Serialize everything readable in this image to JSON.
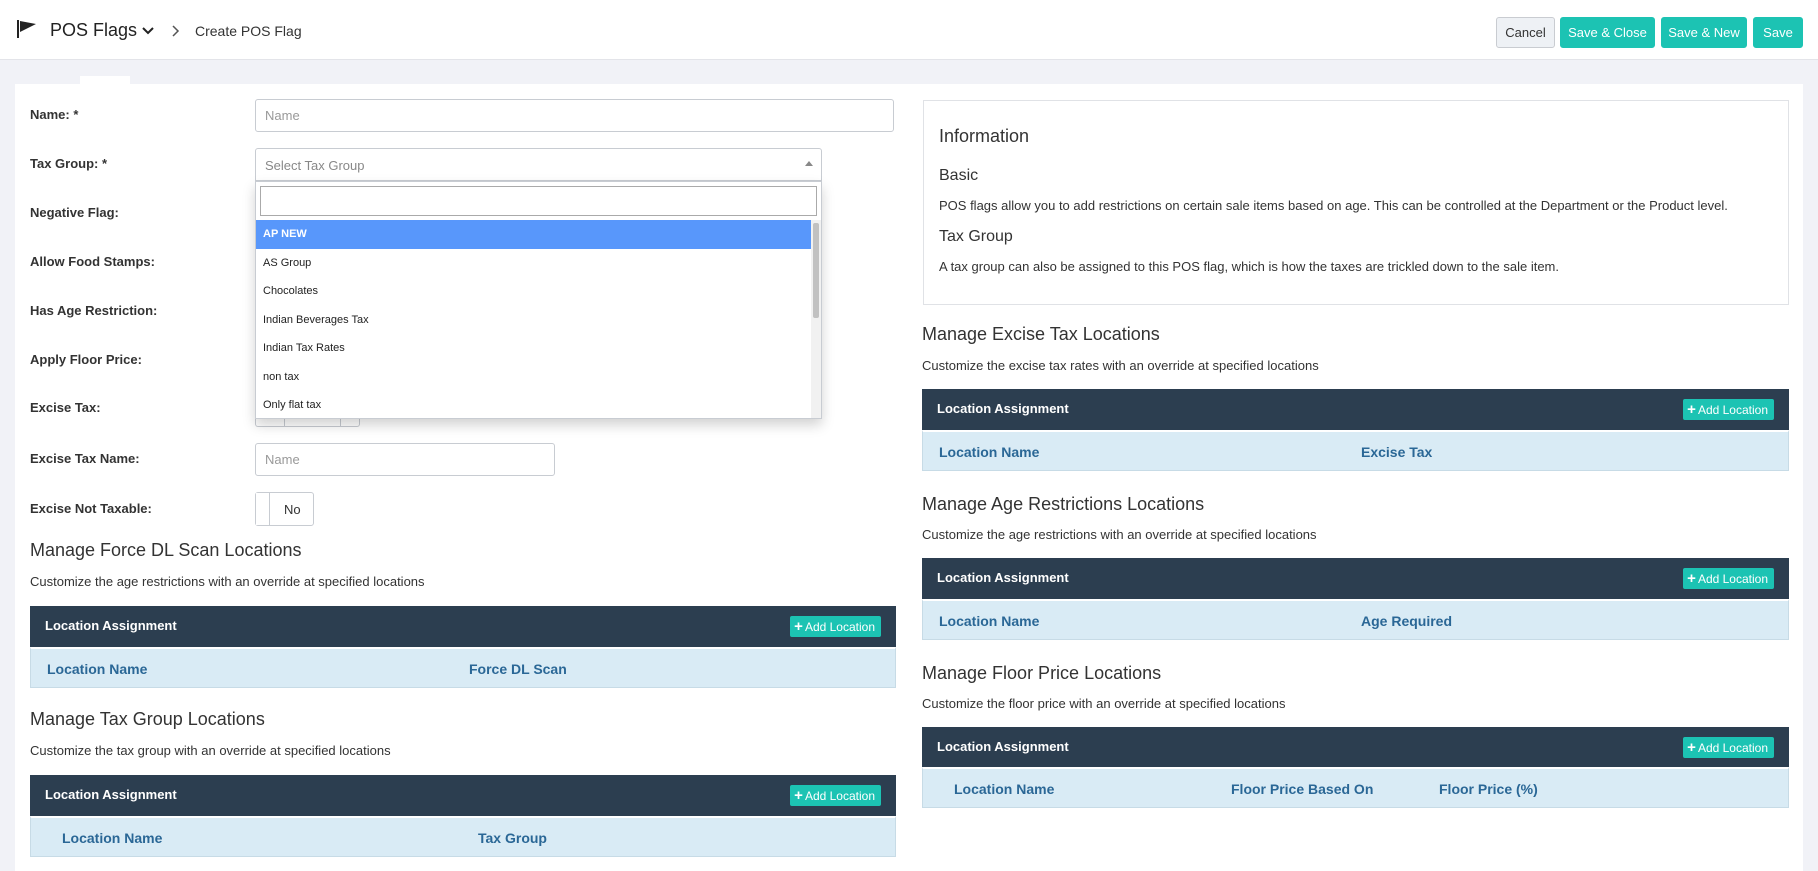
{
  "header": {
    "module_title": "POS Flags",
    "breadcrumb": "Create POS Flag",
    "cancel_label": "Cancel",
    "save_close_label": "Save & Close",
    "save_new_label": "Save & New",
    "save_label": "Save"
  },
  "colors": {
    "accent": "#1cc3b3",
    "dark_bar": "#2c3e50",
    "column_row": "#d9ebf5",
    "selected": "#5897fb"
  },
  "form": {
    "name_label": "Name: *",
    "name_placeholder": "Name",
    "tax_group_label": "Tax Group: *",
    "tax_group_placeholder": "Select Tax Group",
    "negative_flag_label": "Negative Flag:",
    "allow_food_stamps_label": "Allow Food Stamps:",
    "has_age_restriction_label": "Has Age Restriction:",
    "apply_floor_price_label": "Apply Floor Price:",
    "excise_tax_label": "Excise Tax:",
    "excise_tax_name_label": "Excise Tax Name:",
    "excise_tax_name_placeholder": "Name",
    "excise_not_taxable_label": "Excise Not Taxable:",
    "excise_not_taxable_value": "No"
  },
  "dropdown": {
    "options": [
      "AP NEW",
      "AS Group",
      "Chocolates",
      "Indian Beverages Tax",
      "Indian Tax Rates",
      "non tax",
      "Only flat tax"
    ],
    "selected_index": 0
  },
  "info": {
    "heading": "Information",
    "basic_title": "Basic",
    "basic_text": "POS flags allow you to add restrictions on certain sale items based on age. This can be controlled at the Department or the Product level.",
    "tax_group_title": "Tax Group",
    "tax_group_text": "A tax group can also be assigned to this POS flag, which is how the taxes are trickled down to the sale item."
  },
  "sections": {
    "force_dl": {
      "title": "Manage Force DL Scan Locations",
      "subtitle": "Customize the age restrictions with an override at specified locations",
      "bar_title": "Location Assignment",
      "add_label": "Add Location",
      "columns": [
        "Location Name",
        "Force DL Scan"
      ]
    },
    "tax_group": {
      "title": "Manage Tax Group Locations",
      "subtitle": "Customize the tax group with an override at specified locations",
      "bar_title": "Location Assignment",
      "add_label": "Add Location",
      "columns": [
        "Location Name",
        "Tax Group"
      ]
    },
    "excise": {
      "title": "Manage Excise Tax Locations",
      "subtitle": "Customize the excise tax rates with an override at specified locations",
      "bar_title": "Location Assignment",
      "add_label": "Add Location",
      "columns": [
        "Location Name",
        "Excise Tax"
      ]
    },
    "age": {
      "title": "Manage Age Restrictions Locations",
      "subtitle": "Customize the age restrictions with an override at specified locations",
      "bar_title": "Location Assignment",
      "add_label": "Add Location",
      "columns": [
        "Location Name",
        "Age Required"
      ]
    },
    "floor": {
      "title": "Manage Floor Price Locations",
      "subtitle": "Customize the floor price with an override at specified locations",
      "bar_title": "Location Assignment",
      "add_label": "Add Location",
      "columns": [
        "Location Name",
        "Floor Price Based On",
        "Floor Price (%)"
      ]
    }
  }
}
